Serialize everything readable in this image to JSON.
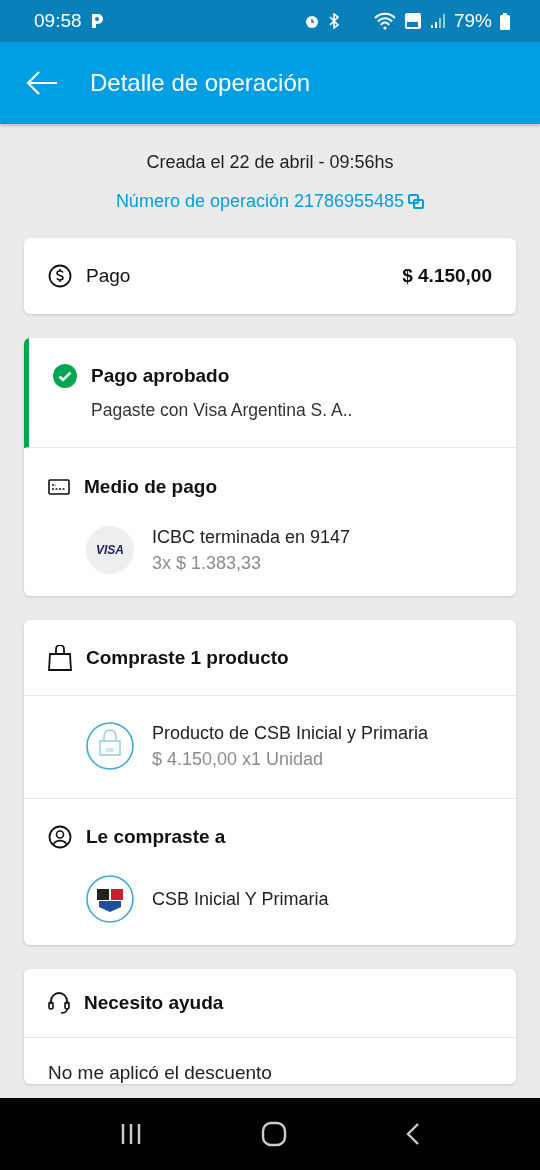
{
  "status_bar": {
    "time": "09:58",
    "battery": "79%"
  },
  "app_bar": {
    "title": "Detalle de operación"
  },
  "header": {
    "created": "Creada el 22 de abril - 09:56hs",
    "operation_number": "Número de operación 21786955485"
  },
  "payment": {
    "label": "Pago",
    "amount": "$ 4.150,00"
  },
  "status": {
    "title": "Pago aprobado",
    "description": "Pagaste con Visa Argentina S. A.."
  },
  "payment_method": {
    "title": "Medio de pago",
    "card_brand": "VISA",
    "card": "ICBC terminada en 9147",
    "installments": "3x $ 1.383,33"
  },
  "purchase": {
    "title": "Compraste 1 producto",
    "products": [
      {
        "name": "Producto de CSB Inicial y Primaria",
        "price": "$ 4.150,00 x1 Unidad"
      }
    ]
  },
  "seller": {
    "title": "Le compraste a",
    "name": "CSB Inicial Y Primaria"
  },
  "help": {
    "title": "Necesito ayuda",
    "options": [
      "No me aplicó el descuento"
    ]
  }
}
